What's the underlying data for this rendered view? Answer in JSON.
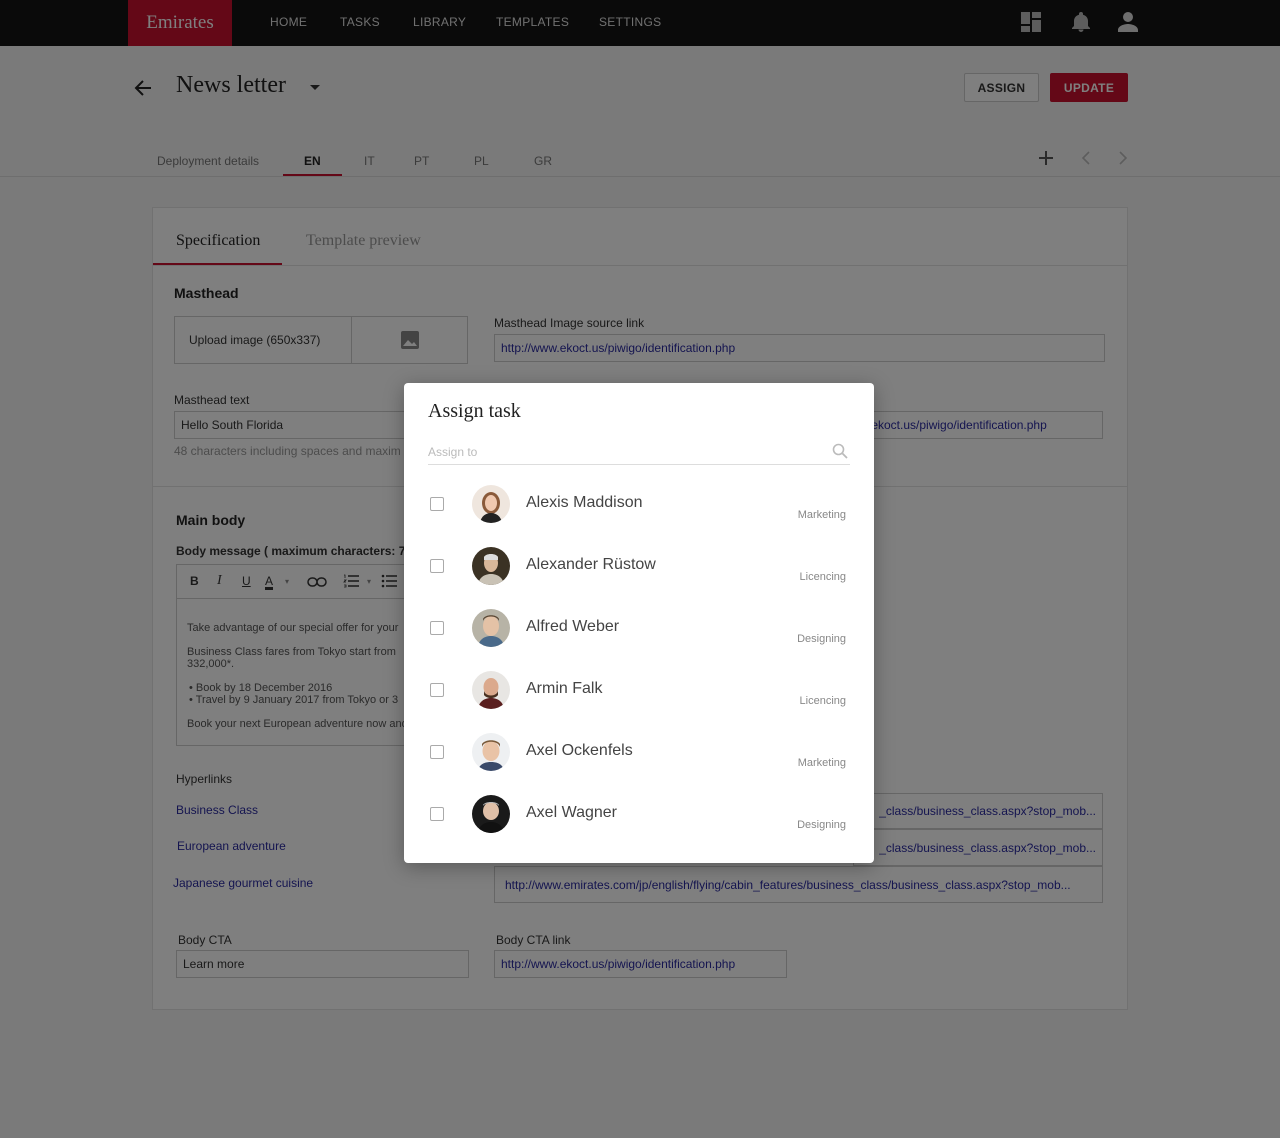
{
  "brand": {
    "logo": "Emirates",
    "accent": "#c8102e"
  },
  "nav": {
    "items": [
      "HOME",
      "TASKS",
      "LIBRARY",
      "TEMPLATES",
      "SETTINGS"
    ]
  },
  "header": {
    "title": "News letter",
    "assign_label": "ASSIGN",
    "update_label": "UPDATE"
  },
  "lang_tabs": {
    "items": [
      "Deployment details",
      "EN",
      "IT",
      "PT",
      "PL",
      "GR"
    ],
    "active": "EN"
  },
  "card": {
    "tabs": [
      "Specification",
      "Template preview"
    ],
    "masthead": {
      "title": "Masthead",
      "upload_label": "Upload image (650x337)",
      "source_label": "Masthead Image source link",
      "source_value": "http://www.ekoct.us/piwigo/identification.php",
      "text_label": "Masthead text",
      "text_value": "Hello South Florida",
      "text_hint": "48 characters including spaces and maxim",
      "link2_value": "w.ekoct.us/piwigo/identification.php"
    },
    "main_body": {
      "title": "Main body",
      "body_label": "Body message ( maximum characters: 70",
      "editor_lines": [
        "Take advantage of our special offer for your",
        "Business Class fares from Tokyo start from",
        "332,000*.",
        "• Book by 18 December 2016",
        "• Travel by 9 January 2017 from Tokyo or 3",
        "Book your next European adventure now and"
      ]
    },
    "hyperlinks": {
      "title": "Hyperlinks",
      "names": [
        "Business Class",
        "European adventure",
        "Japanese gourmet cuisine"
      ],
      "urls": [
        "_class/business_class.aspx?stop_mob...",
        "_class/business_class.aspx?stop_mob...",
        "http://www.emirates.com/jp/english/flying/cabin_features/business_class/business_class.aspx?stop_mob..."
      ]
    },
    "cta": {
      "label": "Body CTA",
      "value": "Learn more",
      "link_label": "Body CTA link",
      "link_value": "http://www.ekoct.us/piwigo/identification.php"
    }
  },
  "modal": {
    "title": "Assign task",
    "search_placeholder": "Assign to",
    "people": [
      {
        "name": "Alexis Maddison",
        "dept": "Marketing"
      },
      {
        "name": "Alexander Rüstow",
        "dept": "Licencing"
      },
      {
        "name": "Alfred Weber",
        "dept": "Designing"
      },
      {
        "name": "Armin Falk",
        "dept": "Licencing"
      },
      {
        "name": "Axel Ockenfels",
        "dept": "Marketing"
      },
      {
        "name": "Axel Wagner",
        "dept": "Designing"
      }
    ]
  }
}
